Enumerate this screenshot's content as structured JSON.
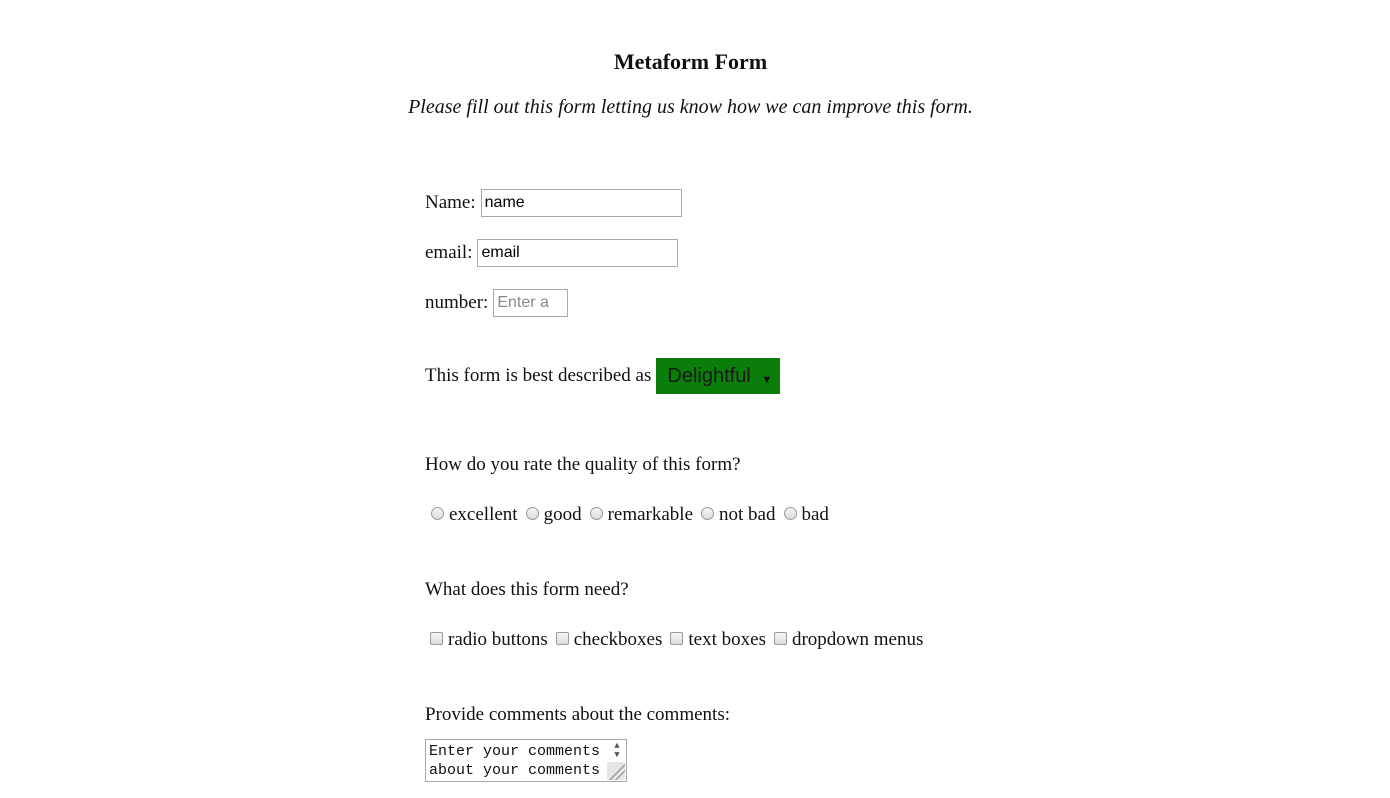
{
  "form": {
    "title": "Metaform Form",
    "subtitle": "Please fill out this form letting us know how we can improve this form."
  },
  "fields": {
    "name_label": "Name:",
    "name_value": "name",
    "email_label": "email:",
    "email_value": "email",
    "number_label": "number:",
    "number_placeholder": "Enter a"
  },
  "description": {
    "label": "This form is best described as",
    "selected": "Delightful",
    "background_color": "#0a7d0a"
  },
  "quality": {
    "question": "How do you rate the quality of this form?",
    "options": [
      "excellent",
      "good",
      "remarkable",
      "not bad",
      "bad"
    ]
  },
  "needs": {
    "question": "What does this form need?",
    "options": [
      "radio buttons",
      "checkboxes",
      "text boxes",
      "dropdown menus"
    ]
  },
  "comments": {
    "label": "Provide comments about the comments:",
    "value": "Enter your comments about your comments"
  }
}
